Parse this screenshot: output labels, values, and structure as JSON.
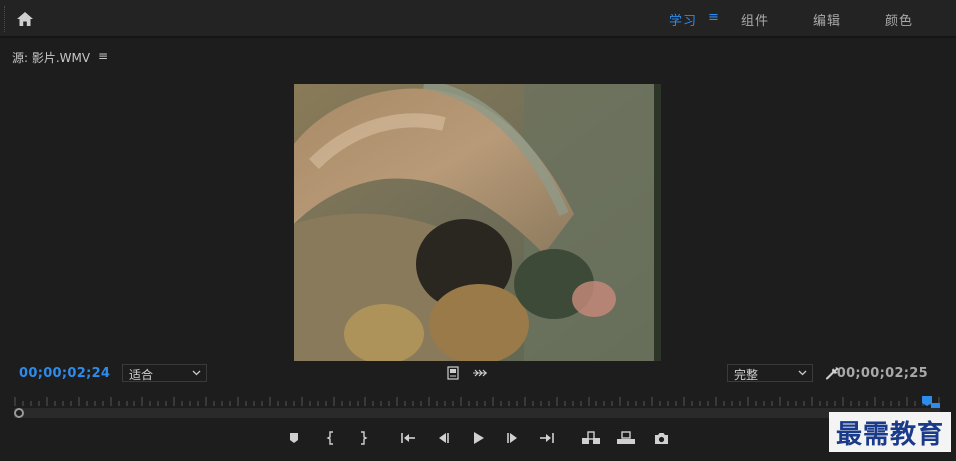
{
  "workspace": {
    "tabs": [
      {
        "label": "学习",
        "active": true
      },
      {
        "label": "组件",
        "active": false
      },
      {
        "label": "编辑",
        "active": false
      },
      {
        "label": "颜色",
        "active": false
      }
    ],
    "menu_glyph": "≡",
    "home_icon": "home-icon"
  },
  "panel": {
    "title": "源: 影片.WMV",
    "menu_glyph": "≡"
  },
  "monitor": {
    "current_timecode": "00;00;02;24",
    "duration_timecode": "00;00;02;25",
    "zoom_select": {
      "value": "适合"
    },
    "resolution_select": {
      "value": "完整"
    },
    "playhead_position": 0.0
  },
  "transport": {
    "buttons": [
      "add-marker",
      "mark-in",
      "mark-out",
      "go-to-in",
      "step-back",
      "play",
      "step-forward",
      "go-to-out",
      "insert",
      "overwrite",
      "export-frame"
    ]
  },
  "watermark": {
    "text": "最需教育"
  },
  "colors": {
    "accent": "#2d8ceb",
    "background": "#1d1d1d",
    "bar": "#232323"
  }
}
